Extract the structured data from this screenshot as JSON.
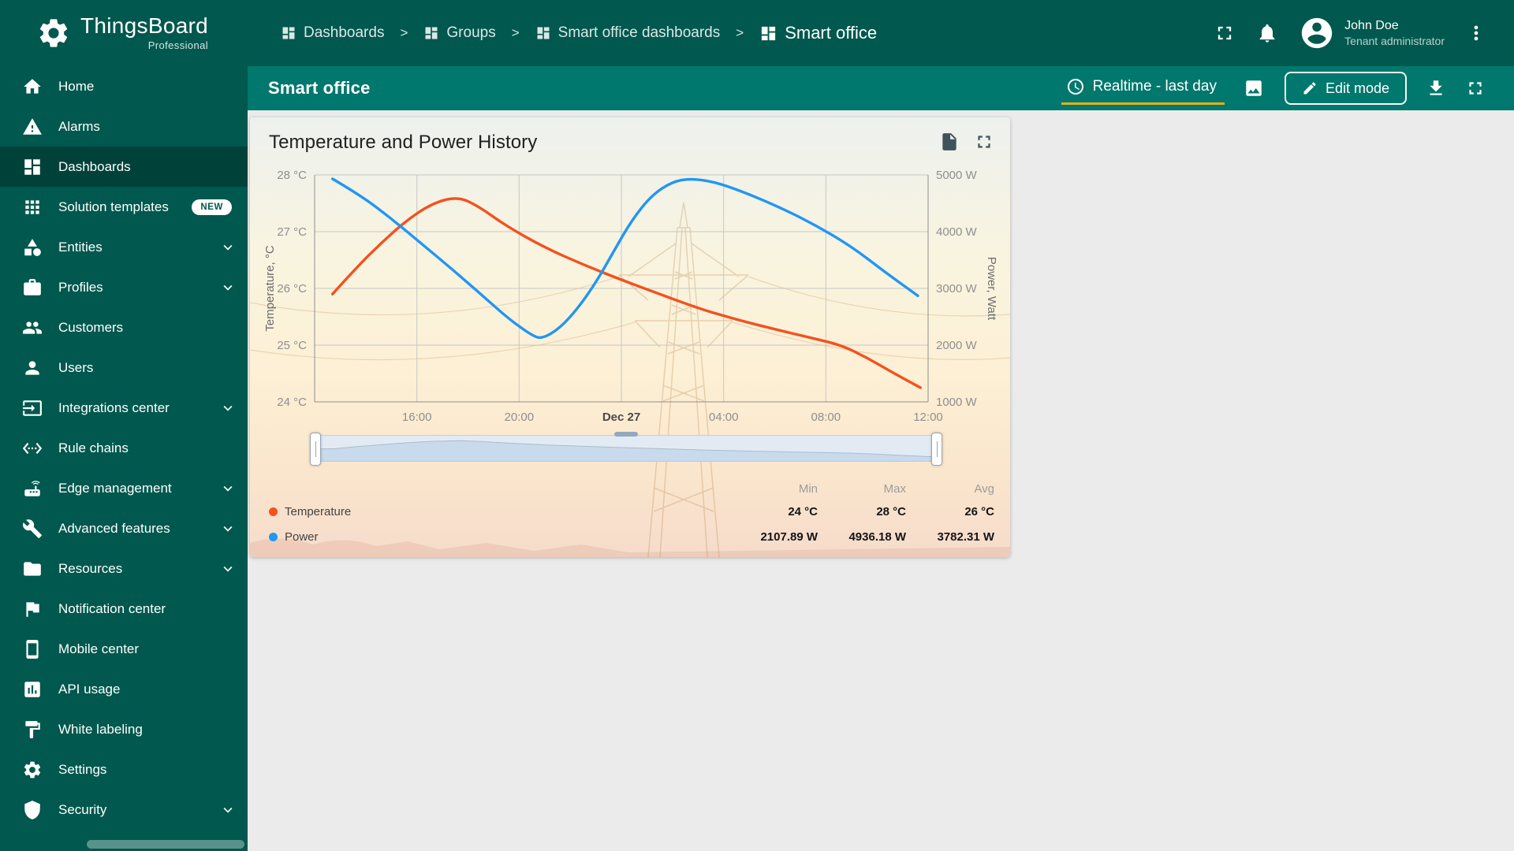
{
  "colors": {
    "header_bg": "#00584e",
    "sidebar_bg": "#00584e",
    "sidebar_active_bg": "#00423a",
    "toolbar_bg": "#00786d",
    "timewindow_underline": "#e3ae1b",
    "canvas_bg": "#ebebeb",
    "temperature_series": "#f4511e",
    "power_series": "#2196f3"
  },
  "icons": {
    "logo": "thingsboard-gear-icon",
    "header": [
      "fullscreen-icon",
      "bell-icon",
      "avatar-icon",
      "more-vert-icon"
    ],
    "breadcrumb": "dashboard-grid-icon",
    "toolbar": [
      "clock-icon",
      "image-icon",
      "pencil-icon",
      "download-icon",
      "fullscreen-icon"
    ],
    "widget": [
      "file-export-icon",
      "fullscreen-icon"
    ]
  },
  "app": {
    "logo_title": "ThingsBoard",
    "logo_subtitle": "Professional"
  },
  "header": {
    "separator": ">",
    "breadcrumbs": [
      {
        "icon": "dashboard-grid",
        "label": "Dashboards"
      },
      {
        "icon": "dashboard-grid",
        "label": "Groups"
      },
      {
        "icon": "dashboard-grid",
        "label": "Smart office dashboards"
      },
      {
        "icon": "dashboard-grid",
        "label": "Smart office"
      }
    ],
    "user": {
      "name": "John Doe",
      "role": "Tenant administrator"
    }
  },
  "sidebar": {
    "items": [
      {
        "label": "Home",
        "icon": "home"
      },
      {
        "label": "Alarms",
        "icon": "alarms"
      },
      {
        "label": "Dashboards",
        "icon": "dashboards",
        "active": true
      },
      {
        "label": "Solution templates",
        "icon": "solution-templates",
        "badge": "NEW"
      },
      {
        "label": "Entities",
        "icon": "entities",
        "chevron": true
      },
      {
        "label": "Profiles",
        "icon": "profiles",
        "chevron": true
      },
      {
        "label": "Customers",
        "icon": "customers"
      },
      {
        "label": "Users",
        "icon": "users"
      },
      {
        "label": "Integrations center",
        "icon": "integrations",
        "chevron": true
      },
      {
        "label": "Rule chains",
        "icon": "rule-chains"
      },
      {
        "label": "Edge management",
        "icon": "edge",
        "chevron": true
      },
      {
        "label": "Advanced features",
        "icon": "advanced",
        "chevron": true
      },
      {
        "label": "Resources",
        "icon": "resources",
        "chevron": true
      },
      {
        "label": "Notification center",
        "icon": "notification"
      },
      {
        "label": "Mobile center",
        "icon": "mobile"
      },
      {
        "label": "API usage",
        "icon": "api"
      },
      {
        "label": "White labeling",
        "icon": "white-labeling"
      },
      {
        "label": "Settings",
        "icon": "settings"
      },
      {
        "label": "Security",
        "icon": "security",
        "chevron": true
      }
    ]
  },
  "toolbar": {
    "title": "Smart office",
    "timewindow_label": "Realtime - last day",
    "edit_button_label": "Edit mode"
  },
  "widget": {
    "title": "Temperature and Power History",
    "legend": {
      "columns": [
        "Min",
        "Max",
        "Avg"
      ],
      "rows": [
        {
          "name": "Temperature",
          "color": "#f4511e",
          "values": [
            "24 °C",
            "28 °C",
            "26 °C"
          ]
        },
        {
          "name": "Power",
          "color": "#2196f3",
          "values": [
            "2107.89 W",
            "4936.18 W",
            "3782.31 W"
          ]
        }
      ]
    }
  },
  "chart_data": {
    "type": "line",
    "title": "Temperature and Power History",
    "grid": true,
    "legend_position": "bottom",
    "x_unit": "hours from 12:00 Dec 26",
    "x_range": [
      0,
      24
    ],
    "x_ticks": [
      {
        "pos": 4,
        "label": "16:00"
      },
      {
        "pos": 8,
        "label": "20:00"
      },
      {
        "pos": 12,
        "label": "Dec 27",
        "bold": true
      },
      {
        "pos": 16,
        "label": "04:00"
      },
      {
        "pos": 20,
        "label": "08:00"
      },
      {
        "pos": 24,
        "label": "12:00"
      }
    ],
    "y_left": {
      "label": "Temperature, °C",
      "range": [
        24,
        28
      ],
      "ticks": [
        {
          "value": 28,
          "label": "28 °C"
        },
        {
          "value": 27,
          "label": "27 °C"
        },
        {
          "value": 26,
          "label": "26 °C"
        },
        {
          "value": 25,
          "label": "25 °C"
        },
        {
          "value": 24,
          "label": "24 °C"
        }
      ]
    },
    "y_right": {
      "label": "Power, Watt",
      "range": [
        1000,
        5000
      ],
      "ticks": [
        {
          "value": 5000,
          "label": "5000 W"
        },
        {
          "value": 4000,
          "label": "4000 W"
        },
        {
          "value": 3000,
          "label": "3000 W"
        },
        {
          "value": 2000,
          "label": "2000 W"
        },
        {
          "value": 1000,
          "label": "1000 W"
        }
      ]
    },
    "series": [
      {
        "name": "Temperature",
        "axis": "left",
        "color": "#f4511e",
        "stats": {
          "min": "24 °C",
          "max": "28 °C",
          "avg": "26 °C"
        },
        "points": [
          [
            0.7,
            25.9
          ],
          [
            1.6,
            26.35
          ],
          [
            2.6,
            26.8
          ],
          [
            3.6,
            27.2
          ],
          [
            4.6,
            27.5
          ],
          [
            5.6,
            27.62
          ],
          [
            6.4,
            27.45
          ],
          [
            7.5,
            27.1
          ],
          [
            9,
            26.72
          ],
          [
            10.5,
            26.42
          ],
          [
            12,
            26.15
          ],
          [
            13.5,
            25.9
          ],
          [
            15,
            25.65
          ],
          [
            16.5,
            25.45
          ],
          [
            18,
            25.28
          ],
          [
            19.5,
            25.12
          ],
          [
            20.6,
            25.0
          ],
          [
            21.6,
            24.78
          ],
          [
            22.6,
            24.52
          ],
          [
            23.7,
            24.25
          ]
        ]
      },
      {
        "name": "Power",
        "axis": "right",
        "color": "#2196f3",
        "stats": {
          "min": "2107.89 W",
          "max": "4936.18 W",
          "avg": "3782.31 W"
        },
        "points": [
          [
            0.7,
            4930
          ],
          [
            1.8,
            4640
          ],
          [
            3,
            4230
          ],
          [
            4.2,
            3780
          ],
          [
            5.4,
            3330
          ],
          [
            6.6,
            2860
          ],
          [
            7.6,
            2460
          ],
          [
            8.5,
            2170
          ],
          [
            8.9,
            2110
          ],
          [
            9.6,
            2300
          ],
          [
            10.3,
            2650
          ],
          [
            11,
            3100
          ],
          [
            11.7,
            3650
          ],
          [
            12.4,
            4200
          ],
          [
            13.2,
            4650
          ],
          [
            14,
            4880
          ],
          [
            14.7,
            4936
          ],
          [
            15.6,
            4880
          ],
          [
            16.6,
            4730
          ],
          [
            18,
            4470
          ],
          [
            19.5,
            4140
          ],
          [
            21,
            3740
          ],
          [
            22.3,
            3290
          ],
          [
            23.6,
            2870
          ]
        ]
      }
    ]
  },
  "slider": {
    "selected_range": [
      0,
      24
    ]
  }
}
